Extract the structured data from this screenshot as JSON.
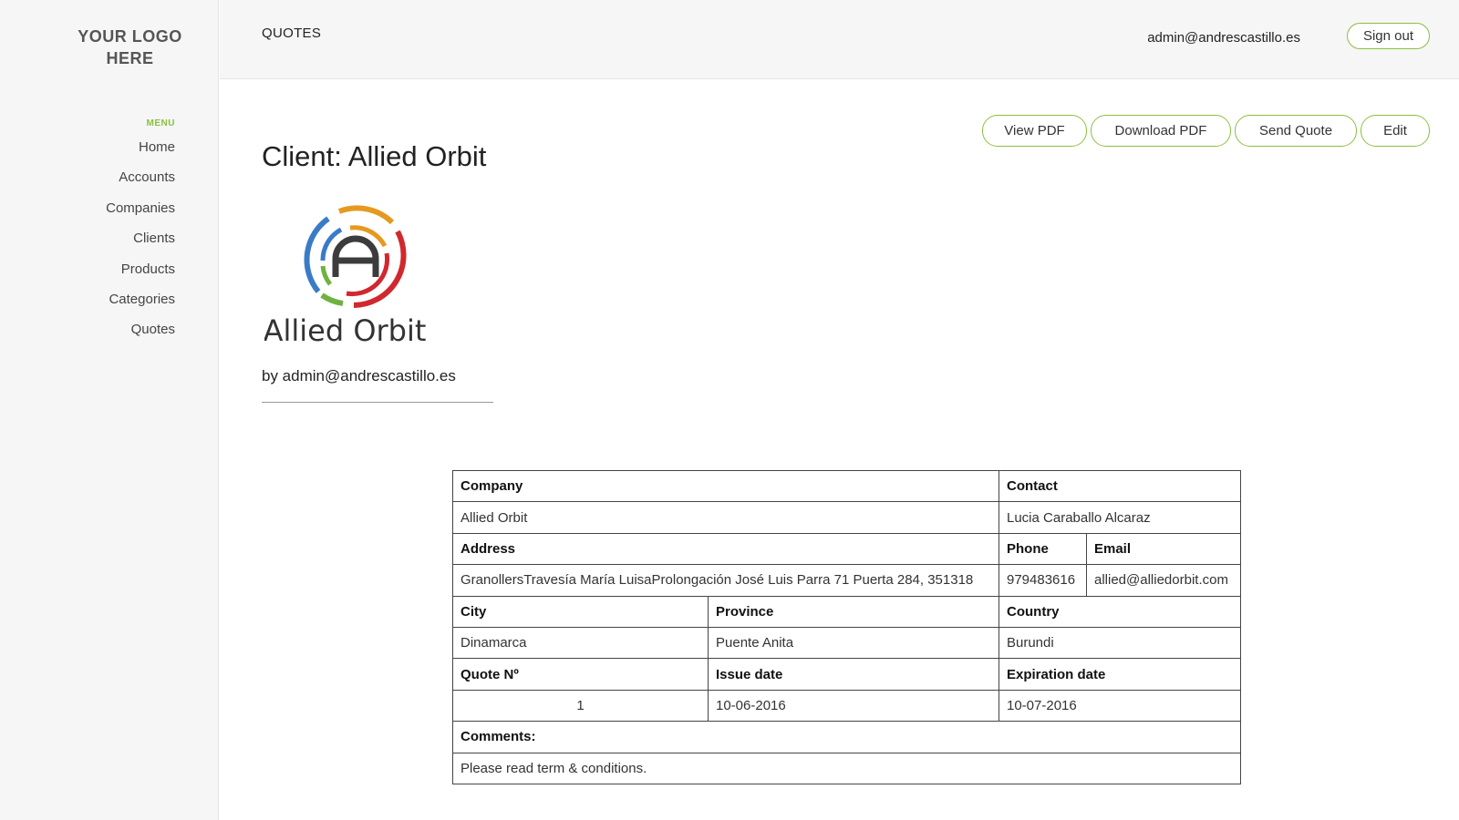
{
  "sidebar": {
    "logo_line1": "YOUR LOGO",
    "logo_line2": "HERE",
    "menu_heading": "MENU",
    "items": [
      {
        "label": "Home"
      },
      {
        "label": "Accounts"
      },
      {
        "label": "Companies"
      },
      {
        "label": "Clients"
      },
      {
        "label": "Products"
      },
      {
        "label": "Categories"
      },
      {
        "label": "Quotes"
      }
    ]
  },
  "header": {
    "section": "QUOTES",
    "user_email": "admin@andrescastillo.es",
    "sign_out_label": "Sign out"
  },
  "actions": {
    "view_pdf": "View PDF",
    "download_pdf": "Download PDF",
    "send_quote": "Send Quote",
    "edit": "Edit"
  },
  "client": {
    "title": "Client: Allied Orbit",
    "logo_text": "Allied Orbit",
    "by": "by admin@andrescastillo.es"
  },
  "quote": {
    "company_label": "Company",
    "company": "Allied Orbit",
    "contact_label": "Contact",
    "contact": "Lucia Caraballo Alcaraz",
    "address_label": "Address",
    "address": "GranollersTravesía María LuisaProlongación José Luis Parra 71 Puerta 284, 351318",
    "phone_label": "Phone",
    "phone": "979483616",
    "email_label": "Email",
    "email": "allied@alliedorbit.com",
    "city_label": "City",
    "city": "Dinamarca",
    "province_label": "Province",
    "province": "Puente Anita",
    "country_label": "Country",
    "country": "Burundi",
    "number_label": "Quote Nº",
    "number": "1",
    "issue_label": "Issue date",
    "issue_date": "10-06-2016",
    "expiration_label": "Expiration date",
    "expiration_date": "10-07-2016",
    "comments_label": "Comments:",
    "comments": "Please read term & conditions."
  },
  "colors": {
    "accent": "#8cbf3f",
    "sidebar_bg": "#f6f6f6",
    "logo_blue": "#3a7bc8",
    "logo_orange": "#e59a1f",
    "logo_red": "#d0282e",
    "logo_green": "#6fb23f",
    "logo_dark": "#3c3c3c"
  }
}
